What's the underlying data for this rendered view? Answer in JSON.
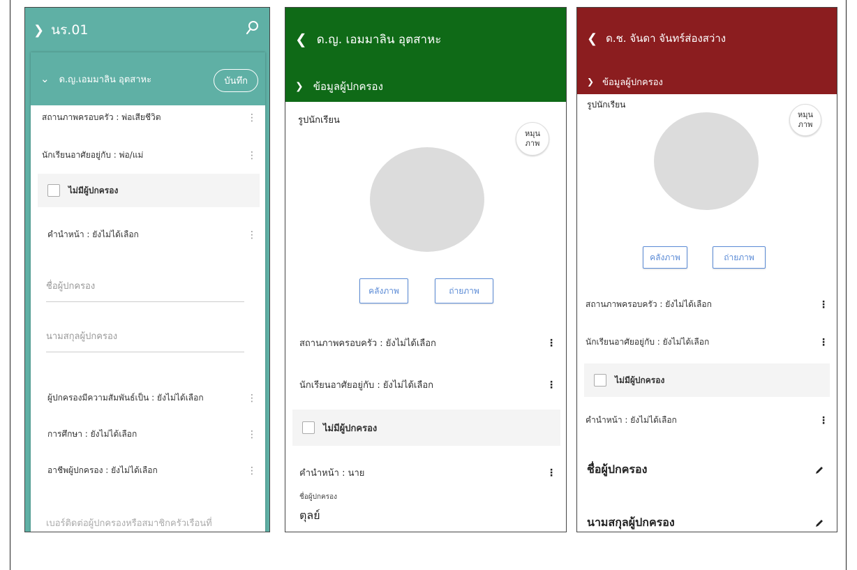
{
  "panel1": {
    "header_title": "นร.01",
    "student_name": "ด.ญ.เอมมาลิน อุตสาหะ",
    "save_label": "บันทึก",
    "family_status": "สถานภาพครอบครัว : พ่อเสียชีวิต",
    "lives_with": "นักเรียนอาศัยอยู่กับ : พ่อ/แม่",
    "no_guardian": "ไม่มีผู้ปกครอง",
    "prefix": "คำนำหน้า : ยังไม่ได้เลือก",
    "guardian_name_placeholder": "ชื่อผู้ปกครอง",
    "guardian_surname_placeholder": "นามสกุลผู้ปกครอง",
    "relationship": "ผู้ปกครองมีความสัมพันธ์เป็น : ยังไม่ได้เลือก",
    "education": "การศึกษา : ยังไม่ได้เลือก",
    "occupation": "อาชีพผู้ปกครอง : ยังไม่ได้เลือก",
    "phone_placeholder": "เบอร์ติดต่อผู้ปกครองหรือสมาชิกครัวเรือนที่"
  },
  "panel2": {
    "header_title": "ด.ญ. เอมมาลิน อุตสาหะ",
    "section_title": "ข้อมูลผู้ปกครอง",
    "photo_label": "รูปนักเรียน",
    "rotate_line1": "หมุน",
    "rotate_line2": "ภาพ",
    "gallery_label": "คลังภาพ",
    "camera_label": "ถ่ายภาพ",
    "family_status": "สถานภาพครอบครัว : ยังไม่ได้เลือก",
    "lives_with": "นักเรียนอาศัยอยู่กับ : ยังไม่ได้เลือก",
    "no_guardian": "ไม่มีผู้ปกครอง",
    "prefix": "คำนำหน้า : นาย",
    "guardian_name_label": "ชื่อผู้ปกครอง",
    "guardian_name_value": "ตุลย์"
  },
  "panel3": {
    "header_title": "ด.ช. จันดา จันทร์ส่องสว่าง",
    "section_title": "ข้อมูลผู้ปกครอง",
    "photo_label": "รูปนักเรียน",
    "rotate_line1": "หมุน",
    "rotate_line2": "ภาพ",
    "gallery_label": "คลังภาพ",
    "camera_label": "ถ่ายภาพ",
    "family_status": "สถานภาพครอบครัว : ยังไม่ได้เลือก",
    "lives_with": "นักเรียนอาศัยอยู่กับ : ยังไม่ได้เลือก",
    "no_guardian": "ไม่มีผู้ปกครอง",
    "prefix": "คำนำหน้า : ยังไม่ได้เลือก",
    "guardian_name": "ชื่อผู้ปกครอง",
    "guardian_surname": "นามสกุลผู้ปกครอง"
  },
  "colors": {
    "teal": "#5fb0a5",
    "green": "#0f6a17",
    "maroon": "#8b1d1f",
    "button_blue": "#5b8bd6"
  }
}
